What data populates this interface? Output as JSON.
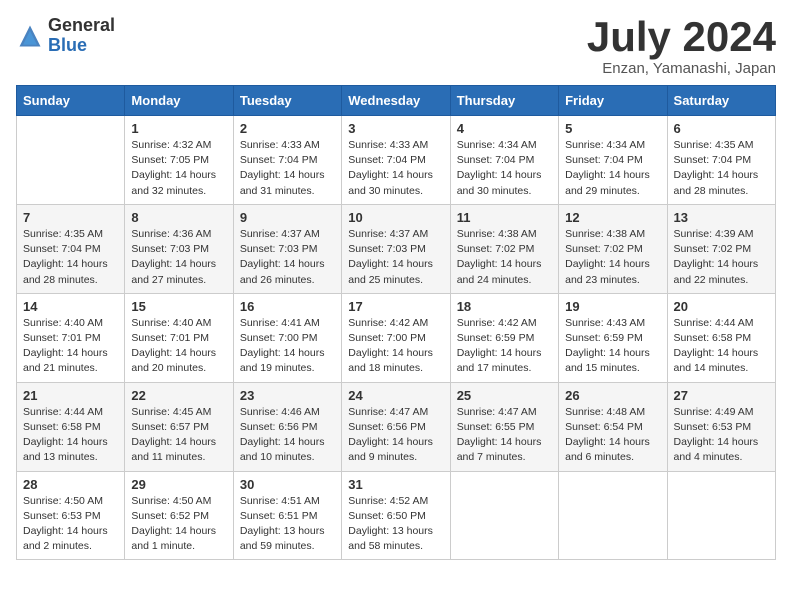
{
  "logo": {
    "general": "General",
    "blue": "Blue"
  },
  "title": {
    "month_year": "July 2024",
    "location": "Enzan, Yamanashi, Japan"
  },
  "headers": [
    "Sunday",
    "Monday",
    "Tuesday",
    "Wednesday",
    "Thursday",
    "Friday",
    "Saturday"
  ],
  "weeks": [
    [
      {
        "day": "",
        "info": ""
      },
      {
        "day": "1",
        "info": "Sunrise: 4:32 AM\nSunset: 7:05 PM\nDaylight: 14 hours\nand 32 minutes."
      },
      {
        "day": "2",
        "info": "Sunrise: 4:33 AM\nSunset: 7:04 PM\nDaylight: 14 hours\nand 31 minutes."
      },
      {
        "day": "3",
        "info": "Sunrise: 4:33 AM\nSunset: 7:04 PM\nDaylight: 14 hours\nand 30 minutes."
      },
      {
        "day": "4",
        "info": "Sunrise: 4:34 AM\nSunset: 7:04 PM\nDaylight: 14 hours\nand 30 minutes."
      },
      {
        "day": "5",
        "info": "Sunrise: 4:34 AM\nSunset: 7:04 PM\nDaylight: 14 hours\nand 29 minutes."
      },
      {
        "day": "6",
        "info": "Sunrise: 4:35 AM\nSunset: 7:04 PM\nDaylight: 14 hours\nand 28 minutes."
      }
    ],
    [
      {
        "day": "7",
        "info": "Sunrise: 4:35 AM\nSunset: 7:04 PM\nDaylight: 14 hours\nand 28 minutes."
      },
      {
        "day": "8",
        "info": "Sunrise: 4:36 AM\nSunset: 7:03 PM\nDaylight: 14 hours\nand 27 minutes."
      },
      {
        "day": "9",
        "info": "Sunrise: 4:37 AM\nSunset: 7:03 PM\nDaylight: 14 hours\nand 26 minutes."
      },
      {
        "day": "10",
        "info": "Sunrise: 4:37 AM\nSunset: 7:03 PM\nDaylight: 14 hours\nand 25 minutes."
      },
      {
        "day": "11",
        "info": "Sunrise: 4:38 AM\nSunset: 7:02 PM\nDaylight: 14 hours\nand 24 minutes."
      },
      {
        "day": "12",
        "info": "Sunrise: 4:38 AM\nSunset: 7:02 PM\nDaylight: 14 hours\nand 23 minutes."
      },
      {
        "day": "13",
        "info": "Sunrise: 4:39 AM\nSunset: 7:02 PM\nDaylight: 14 hours\nand 22 minutes."
      }
    ],
    [
      {
        "day": "14",
        "info": "Sunrise: 4:40 AM\nSunset: 7:01 PM\nDaylight: 14 hours\nand 21 minutes."
      },
      {
        "day": "15",
        "info": "Sunrise: 4:40 AM\nSunset: 7:01 PM\nDaylight: 14 hours\nand 20 minutes."
      },
      {
        "day": "16",
        "info": "Sunrise: 4:41 AM\nSunset: 7:00 PM\nDaylight: 14 hours\nand 19 minutes."
      },
      {
        "day": "17",
        "info": "Sunrise: 4:42 AM\nSunset: 7:00 PM\nDaylight: 14 hours\nand 18 minutes."
      },
      {
        "day": "18",
        "info": "Sunrise: 4:42 AM\nSunset: 6:59 PM\nDaylight: 14 hours\nand 17 minutes."
      },
      {
        "day": "19",
        "info": "Sunrise: 4:43 AM\nSunset: 6:59 PM\nDaylight: 14 hours\nand 15 minutes."
      },
      {
        "day": "20",
        "info": "Sunrise: 4:44 AM\nSunset: 6:58 PM\nDaylight: 14 hours\nand 14 minutes."
      }
    ],
    [
      {
        "day": "21",
        "info": "Sunrise: 4:44 AM\nSunset: 6:58 PM\nDaylight: 14 hours\nand 13 minutes."
      },
      {
        "day": "22",
        "info": "Sunrise: 4:45 AM\nSunset: 6:57 PM\nDaylight: 14 hours\nand 11 minutes."
      },
      {
        "day": "23",
        "info": "Sunrise: 4:46 AM\nSunset: 6:56 PM\nDaylight: 14 hours\nand 10 minutes."
      },
      {
        "day": "24",
        "info": "Sunrise: 4:47 AM\nSunset: 6:56 PM\nDaylight: 14 hours\nand 9 minutes."
      },
      {
        "day": "25",
        "info": "Sunrise: 4:47 AM\nSunset: 6:55 PM\nDaylight: 14 hours\nand 7 minutes."
      },
      {
        "day": "26",
        "info": "Sunrise: 4:48 AM\nSunset: 6:54 PM\nDaylight: 14 hours\nand 6 minutes."
      },
      {
        "day": "27",
        "info": "Sunrise: 4:49 AM\nSunset: 6:53 PM\nDaylight: 14 hours\nand 4 minutes."
      }
    ],
    [
      {
        "day": "28",
        "info": "Sunrise: 4:50 AM\nSunset: 6:53 PM\nDaylight: 14 hours\nand 2 minutes."
      },
      {
        "day": "29",
        "info": "Sunrise: 4:50 AM\nSunset: 6:52 PM\nDaylight: 14 hours\nand 1 minute."
      },
      {
        "day": "30",
        "info": "Sunrise: 4:51 AM\nSunset: 6:51 PM\nDaylight: 13 hours\nand 59 minutes."
      },
      {
        "day": "31",
        "info": "Sunrise: 4:52 AM\nSunset: 6:50 PM\nDaylight: 13 hours\nand 58 minutes."
      },
      {
        "day": "",
        "info": ""
      },
      {
        "day": "",
        "info": ""
      },
      {
        "day": "",
        "info": ""
      }
    ]
  ]
}
